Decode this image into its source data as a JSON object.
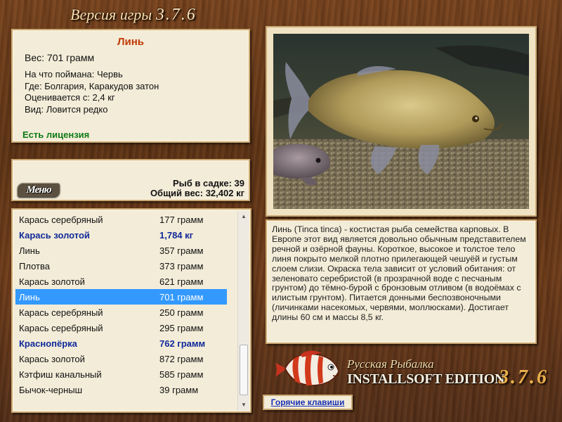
{
  "header": {
    "title_prefix": "Версия игры",
    "version": "3.7.6"
  },
  "fish_info": {
    "name": "Линь",
    "weight": "Вес: 701 грамм",
    "bait": "На что поймана: Червь",
    "location": "Где: Болгария, Каракудов затон",
    "value": "Оценивается с: 2,4 кг",
    "rarity": "Вид: Ловится редко",
    "license": "Есть лицензия"
  },
  "stats": {
    "menu_label": "Меню",
    "fish_count": "Рыб в садке: 39",
    "total_weight": "Общий вес: 32,402 кг"
  },
  "catch_list": [
    {
      "name": "Карась серебряный",
      "weight": "177 грамм",
      "bold": false,
      "selected": false
    },
    {
      "name": "Карась золотой",
      "weight": "1,784 кг",
      "bold": true,
      "selected": false
    },
    {
      "name": "Линь",
      "weight": "357 грамм",
      "bold": false,
      "selected": false
    },
    {
      "name": "Плотва",
      "weight": "373 грамм",
      "bold": false,
      "selected": false
    },
    {
      "name": "Карась золотой",
      "weight": "621 грамм",
      "bold": false,
      "selected": false
    },
    {
      "name": "Линь",
      "weight": "701 грамм",
      "bold": false,
      "selected": true
    },
    {
      "name": "Карась серебряный",
      "weight": "250 грамм",
      "bold": false,
      "selected": false
    },
    {
      "name": "Карась серебряный",
      "weight": "295 грамм",
      "bold": false,
      "selected": false
    },
    {
      "name": "Краснопёрка",
      "weight": "762 грамм",
      "bold": true,
      "selected": false
    },
    {
      "name": "Карась золотой",
      "weight": "872 грамм",
      "bold": false,
      "selected": false
    },
    {
      "name": "Кэтфиш канальный",
      "weight": "585 грамм",
      "bold": false,
      "selected": false
    },
    {
      "name": "Бычок-черныш",
      "weight": "39 грамм",
      "bold": false,
      "selected": false
    }
  ],
  "description": "Линь (Tinca tinca) - костистая рыба семейства карповых. В Европе этот вид является довольно обычным представителем речной и озёрной фауны. Короткое, высокое и толстое тело линя покрыто мелкой плотно прилегающей чешуёй и густым слоем слизи. Окраска тела зависит от условий обитания: от зеленовато серебристой (в прозрачной воде с песчаным грунтом) до тёмно-бурой с бронзовым отливом (в водоёмах с илистым грунтом). Питается донными беспозвоночными (личинками насекомых, червями, моллюсками). Достигает длины 60 см и массы 8,5 кг.",
  "logo": {
    "subtitle": "Русская Рыбалка",
    "edition": "INSTALLSOFT EDITION",
    "version": "3.7.6"
  },
  "hotkeys_label": "Горячие клавиши",
  "colors": {
    "accent_name": "#c23a06",
    "license": "#0e7a16",
    "bold_item": "#102a9a",
    "selection": "#3399ff",
    "panel": "#f3ecd8",
    "wood": "#6b3a1a"
  },
  "icons": {
    "logo_image": "striped-fish-icon",
    "scroll_up": "scroll-up-arrow",
    "scroll_down": "scroll-down-arrow"
  }
}
